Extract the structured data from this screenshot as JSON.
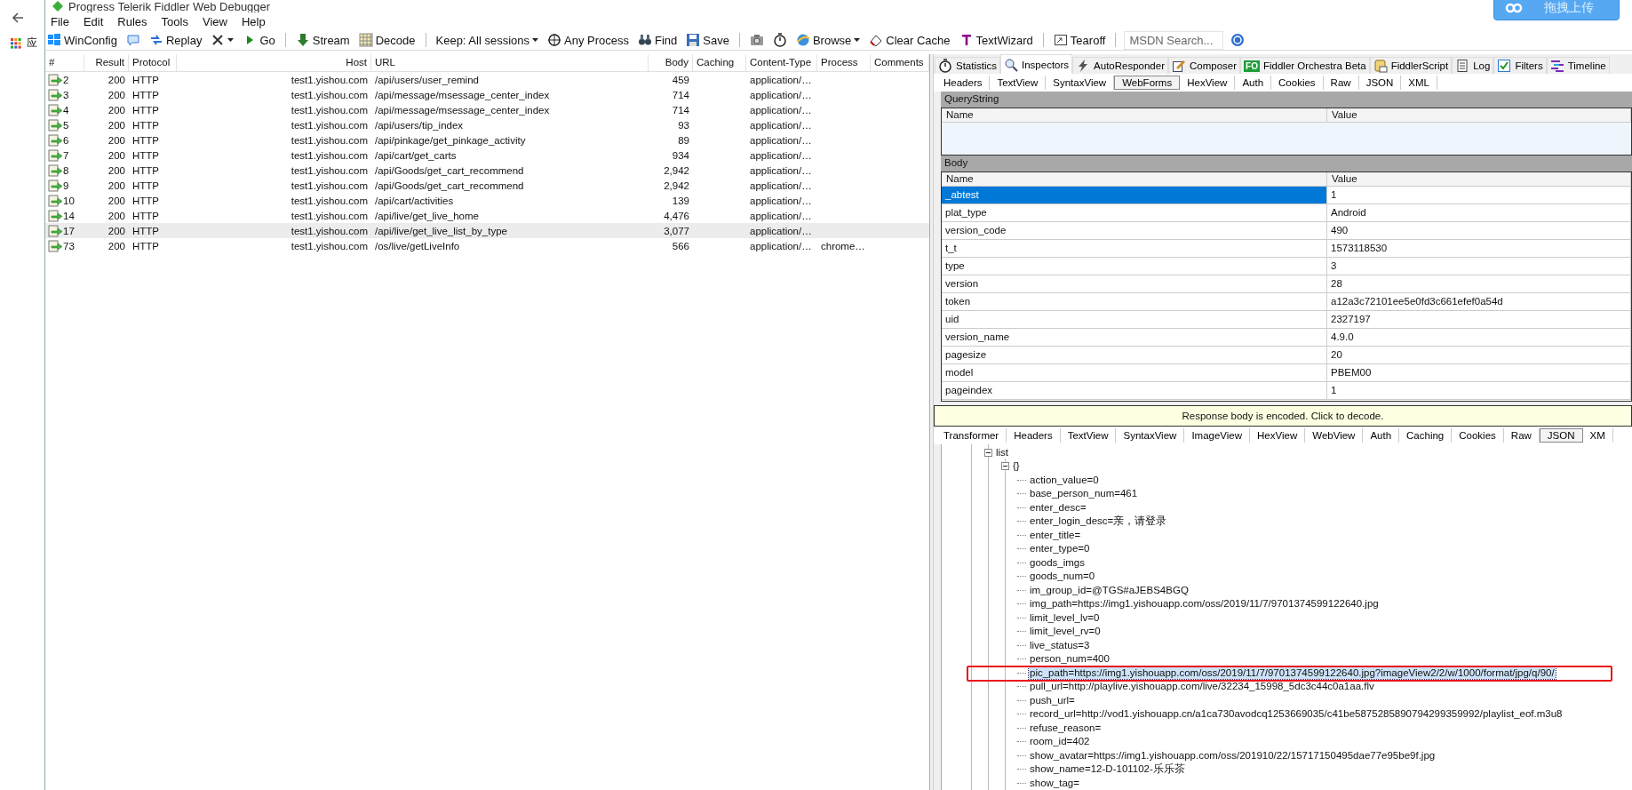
{
  "browser": {
    "apps_label": "应"
  },
  "upload_button": {
    "label": "拖拽上传"
  },
  "window": {
    "title": "Progress Telerik Fiddler Web Debugger"
  },
  "menu": [
    "File",
    "Edit",
    "Rules",
    "Tools",
    "View",
    "Help"
  ],
  "toolbar": [
    [
      {
        "kind": "button",
        "label": "WinConfig"
      },
      {
        "kind": "button"
      },
      {
        "kind": "button",
        "label": "Replay"
      },
      {
        "kind": "dropdown"
      },
      {
        "kind": "button",
        "label": "Go"
      }
    ],
    [
      {
        "kind": "button",
        "label": "Stream"
      },
      {
        "kind": "button",
        "label": "Decode"
      }
    ],
    [
      {
        "kind": "dropdown",
        "label": "Keep: All sessions"
      },
      {
        "kind": "button",
        "label": "Any Process"
      },
      {
        "kind": "button",
        "label": "Find"
      },
      {
        "kind": "button",
        "label": "Save"
      }
    ],
    [
      {
        "kind": "button"
      },
      {
        "kind": "button"
      },
      {
        "kind": "dropdown",
        "label": "Browse"
      },
      {
        "kind": "button",
        "label": "Clear Cache"
      },
      {
        "kind": "button",
        "label": "TextWizard"
      }
    ],
    [
      {
        "kind": "button",
        "label": "Tearoff"
      }
    ],
    [
      {
        "kind": "search",
        "placeholder": "MSDN Search..."
      },
      {
        "kind": "button"
      }
    ]
  ],
  "sessions": {
    "columns": [
      "#",
      "Result",
      "Protocol",
      "Host",
      "URL",
      "Body",
      "Caching",
      "Content-Type",
      "Process",
      "Comments"
    ],
    "rows": [
      {
        "num": "2",
        "result": "200",
        "protocol": "HTTP",
        "host": "test1.yishou.com",
        "url": "/api/users/user_remind",
        "body": "459",
        "content_type": "application/…",
        "selected": false
      },
      {
        "num": "3",
        "result": "200",
        "protocol": "HTTP",
        "host": "test1.yishou.com",
        "url": "/api/message/msessage_center_index",
        "body": "714",
        "content_type": "application/…",
        "selected": false
      },
      {
        "num": "4",
        "result": "200",
        "protocol": "HTTP",
        "host": "test1.yishou.com",
        "url": "/api/message/msessage_center_index",
        "body": "714",
        "content_type": "application/…",
        "selected": false
      },
      {
        "num": "5",
        "result": "200",
        "protocol": "HTTP",
        "host": "test1.yishou.com",
        "url": "/api/users/tip_index",
        "body": "93",
        "content_type": "application/…",
        "selected": false
      },
      {
        "num": "6",
        "result": "200",
        "protocol": "HTTP",
        "host": "test1.yishou.com",
        "url": "/api/pinkage/get_pinkage_activity",
        "body": "89",
        "content_type": "application/…",
        "selected": false
      },
      {
        "num": "7",
        "result": "200",
        "protocol": "HTTP",
        "host": "test1.yishou.com",
        "url": "/api/cart/get_carts",
        "body": "934",
        "content_type": "application/…",
        "selected": false
      },
      {
        "num": "8",
        "result": "200",
        "protocol": "HTTP",
        "host": "test1.yishou.com",
        "url": "/api/Goods/get_cart_recommend",
        "body": "2,942",
        "content_type": "application/…",
        "selected": false
      },
      {
        "num": "9",
        "result": "200",
        "protocol": "HTTP",
        "host": "test1.yishou.com",
        "url": "/api/Goods/get_cart_recommend",
        "body": "2,942",
        "content_type": "application/…",
        "selected": false
      },
      {
        "num": "10",
        "result": "200",
        "protocol": "HTTP",
        "host": "test1.yishou.com",
        "url": "/api/cart/activities",
        "body": "139",
        "content_type": "application/…",
        "selected": false
      },
      {
        "num": "14",
        "result": "200",
        "protocol": "HTTP",
        "host": "test1.yishou.com",
        "url": "/api/live/get_live_home",
        "body": "4,476",
        "content_type": "application/…",
        "selected": false
      },
      {
        "num": "17",
        "result": "200",
        "protocol": "HTTP",
        "host": "test1.yishou.com",
        "url": "/api/live/get_live_list_by_type",
        "body": "3,077",
        "content_type": "application/…",
        "selected": true
      },
      {
        "num": "73",
        "result": "200",
        "protocol": "HTTP",
        "host": "test1.yishou.com",
        "url": "/os/live/getLiveInfo",
        "body": "566",
        "content_type": "application/…",
        "process": "chrome…",
        "selected": false
      }
    ]
  },
  "tabs": [
    {
      "label": "Statistics",
      "selected": false
    },
    {
      "label": "Inspectors",
      "selected": true
    },
    {
      "label": "AutoResponder",
      "selected": false
    },
    {
      "label": "Composer",
      "selected": false
    },
    {
      "label": "Fiddler Orchestra Beta",
      "badge": "FO",
      "selected": false
    },
    {
      "label": "FiddlerScript",
      "selected": false
    },
    {
      "label": "Log",
      "selected": false
    },
    {
      "label": "Filters",
      "selected": false
    },
    {
      "label": "Timeline",
      "selected": false
    }
  ],
  "request": {
    "tabs": [
      {
        "label": "Headers",
        "selected": false
      },
      {
        "label": "TextView",
        "selected": false
      },
      {
        "label": "SyntaxView",
        "selected": false
      },
      {
        "label": "WebForms",
        "selected": true
      },
      {
        "label": "HexView",
        "selected": false
      },
      {
        "label": "Auth",
        "selected": false
      },
      {
        "label": "Cookies",
        "selected": false
      },
      {
        "label": "Raw",
        "selected": false
      },
      {
        "label": "JSON",
        "selected": false
      },
      {
        "label": "XML",
        "selected": false
      }
    ],
    "query_string": {
      "title": "QueryString",
      "columns": [
        "Name",
        "Value"
      ]
    },
    "body": {
      "title": "Body",
      "columns": [
        "Name",
        "Value"
      ],
      "rows": [
        {
          "name": "_abtest",
          "value": "1",
          "selected": true
        },
        {
          "name": "plat_type",
          "value": "Android",
          "selected": false
        },
        {
          "name": "version_code",
          "value": "490",
          "selected": false
        },
        {
          "name": "t_t",
          "value": "1573118530",
          "selected": false
        },
        {
          "name": "type",
          "value": "3",
          "selected": false
        },
        {
          "name": "version",
          "value": "28",
          "selected": false
        },
        {
          "name": "token",
          "value": "a12a3c72101ee5e0fd3c661efef0a54d",
          "selected": false
        },
        {
          "name": "uid",
          "value": "2327197",
          "selected": false
        },
        {
          "name": "version_name",
          "value": "4.9.0",
          "selected": false
        },
        {
          "name": "pagesize",
          "value": "20",
          "selected": false
        },
        {
          "name": "model",
          "value": "PBEM00",
          "selected": false
        },
        {
          "name": "pageindex",
          "value": "1",
          "selected": false
        }
      ]
    }
  },
  "response": {
    "notice": "Response body is encoded. Click to decode.",
    "tabs": [
      {
        "label": "Transformer",
        "selected": false
      },
      {
        "label": "Headers",
        "selected": false
      },
      {
        "label": "TextView",
        "selected": false
      },
      {
        "label": "SyntaxView",
        "selected": false
      },
      {
        "label": "ImageView",
        "selected": false
      },
      {
        "label": "HexView",
        "selected": false
      },
      {
        "label": "WebView",
        "selected": false
      },
      {
        "label": "Auth",
        "selected": false
      },
      {
        "label": "Caching",
        "selected": false
      },
      {
        "label": "Cookies",
        "selected": false
      },
      {
        "label": "Raw",
        "selected": false
      },
      {
        "label": "JSON",
        "selected": true
      },
      {
        "label": "XM",
        "selected": false
      }
    ],
    "tree": [
      {
        "label": "list",
        "expanded": true,
        "selected": false,
        "children": [
          {
            "label": "{}",
            "expanded": true,
            "selected": false,
            "children": [
              {
                "label": "action_value=0",
                "selected": false
              },
              {
                "label": "base_person_num=461",
                "selected": false
              },
              {
                "label": "enter_desc=",
                "selected": false
              },
              {
                "label": "enter_login_desc=亲，请登录",
                "selected": false
              },
              {
                "label": "enter_title=",
                "selected": false
              },
              {
                "label": "enter_type=0",
                "selected": false
              },
              {
                "label": "goods_imgs",
                "selected": false
              },
              {
                "label": "goods_num=0",
                "selected": false
              },
              {
                "label": "im_group_id=@TGS#aJEBS4BGQ",
                "selected": false
              },
              {
                "label": "img_path=https://img1.yishouapp.com/oss/2019/11/7/9701374599122640.jpg",
                "selected": false
              },
              {
                "label": "limit_level_lv=0",
                "selected": false
              },
              {
                "label": "limit_level_rv=0",
                "selected": false
              },
              {
                "label": "live_status=3",
                "selected": false
              },
              {
                "label": "person_num=400",
                "selected": false
              },
              {
                "label": "pic_path=https://img1.yishouapp.com/oss/2019/11/7/9701374599122640.jpg?imageView2/2/w/1000/format/jpg/q/90/",
                "selected": true
              },
              {
                "label": "pull_url=http://playlive.yishouapp.com/live/32234_15998_5dc3c44c0a1aa.flv",
                "selected": false
              },
              {
                "label": "push_url=",
                "selected": false
              },
              {
                "label": "record_url=http://vod1.yishouapp.cn/a1ca730avodcq1253669035/c41be5875285890794299359992/playlist_eof.m3u8",
                "selected": false
              },
              {
                "label": "refuse_reason=",
                "selected": false
              },
              {
                "label": "room_id=402",
                "selected": false
              },
              {
                "label": "show_avatar=https://img1.yishouapp.com/oss/201910/22/15717150495dae77e95be9f.jpg",
                "selected": false
              },
              {
                "label": "show_name=12-D-101102-乐乐茶",
                "selected": false
              },
              {
                "label": "show_tag=",
                "selected": false
              }
            ]
          }
        ]
      }
    ]
  }
}
